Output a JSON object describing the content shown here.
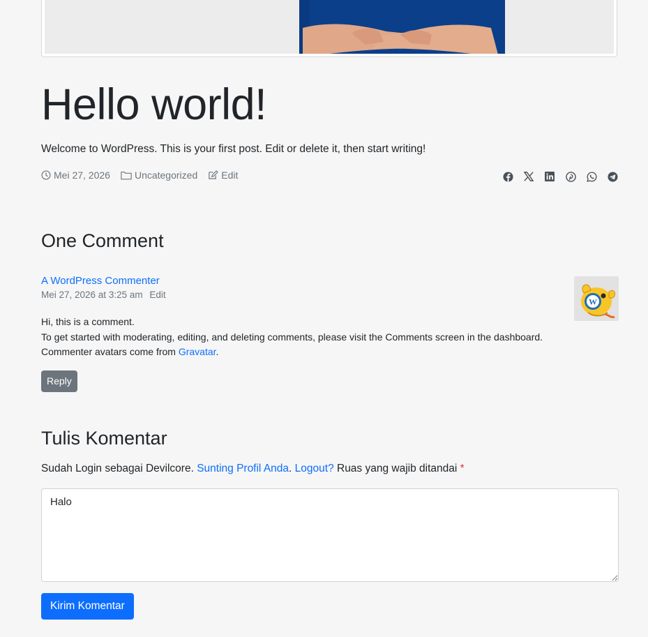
{
  "post": {
    "title": "Hello world!",
    "excerpt": "Welcome to WordPress. This is your first post. Edit or delete it, then start writing!",
    "date": "Mei 27, 2026",
    "category": "Uncategorized",
    "edit_label": "Edit"
  },
  "share": [
    "facebook-icon",
    "x-icon",
    "linkedin-icon",
    "pinterest-icon",
    "whatsapp-icon",
    "telegram-icon"
  ],
  "comments": {
    "title": "One Comment",
    "author": "A WordPress Commenter",
    "datetime": "Mei 27, 2026 at 3:25 am",
    "edit_label": "Edit",
    "line1": "Hi, this is a comment.",
    "line2": "To get started with moderating, editing, and deleting comments, please visit the Comments screen in the dashboard.",
    "line3_prefix": "Commenter avatars come from ",
    "line3_link": "Gravatar",
    "line3_suffix": ".",
    "reply_label": "Reply"
  },
  "reply_form": {
    "title": "Tulis Komentar",
    "logged_prefix": "Sudah Login sebagai Devilcore. ",
    "profile_link": "Sunting Profil Anda",
    "sep": ". ",
    "logout_link": "Logout?",
    "required_text": " Ruas yang wajib ditandai ",
    "required_mark": "*",
    "comment_value": "Halo",
    "submit_label": "Kirim Komentar"
  },
  "colors": {
    "link": "#0d6efd",
    "secondary": "#6c757d",
    "primary": "#0d6efd"
  }
}
